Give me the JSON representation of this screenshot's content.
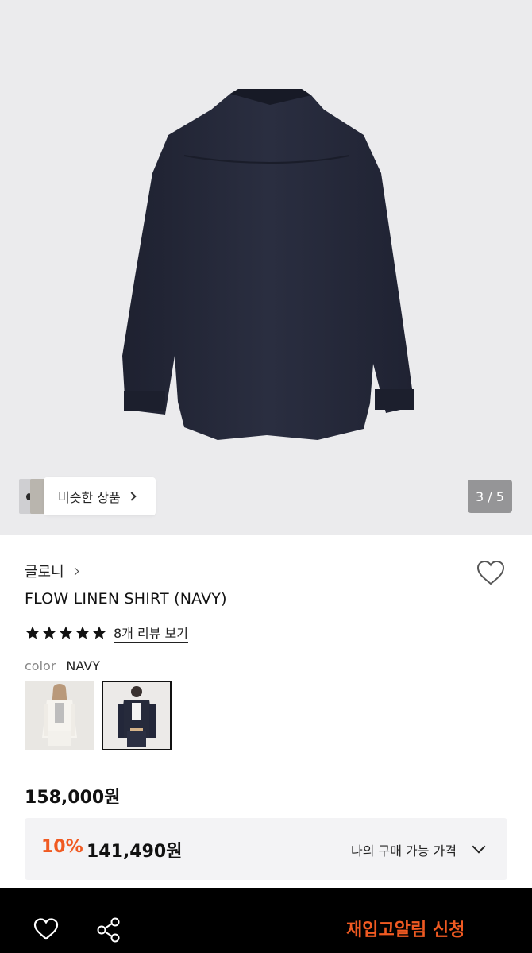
{
  "gallery": {
    "similar_label": "비슷한 상품",
    "counter": "3 / 5"
  },
  "product": {
    "brand": "글로니",
    "title": "FLOW LINEN SHIRT (NAVY)",
    "rating_stars": 5,
    "review_link": "8개 리뷰 보기",
    "color_label": "color",
    "color_value": "NAVY",
    "swatches": [
      "ivory",
      "navy"
    ],
    "selected_swatch": "navy",
    "original_price": "158,000원",
    "discount_percent": "10%",
    "sale_price": "141,490원",
    "my_price_label": "나의 구매 가능 가격"
  },
  "bottom_bar": {
    "restock_label": "재입고알림 신청"
  },
  "colors": {
    "accent": "#f05a22",
    "hero_bg": "#ebebed",
    "shirt": "#262a3b",
    "bottom_bar_bg": "#000000"
  }
}
